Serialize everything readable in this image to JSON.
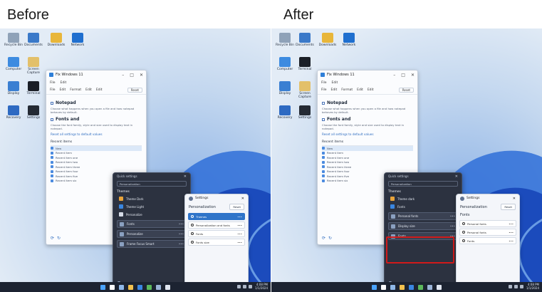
{
  "captions": {
    "before": "Before",
    "after": "After"
  },
  "colors": {
    "highlight": "#d11a1a",
    "accent": "#2f74c9",
    "taskbar": "#1c2331",
    "flyout_bg": "#2c3240"
  },
  "before": {
    "desktop_icons": [
      {
        "label": "Recycle Bin",
        "icon": "recycle-bin-icon",
        "color": "#8fa2b8"
      },
      {
        "label": "Documents",
        "icon": "folder-icon",
        "color": "#3a79c9"
      },
      {
        "label": "Downloads",
        "icon": "downloads-icon",
        "color": "#e8b63a"
      },
      {
        "label": "Network",
        "icon": "network-icon",
        "color": "#1f6fcf"
      },
      {
        "label": "Computer",
        "icon": "computer-icon",
        "color": "#3d8be0"
      },
      {
        "label": "Screen Capture",
        "icon": "capture-icon",
        "color": "#e3c06a"
      },
      {
        "label": "Display",
        "icon": "display-icon",
        "color": "#3a7fd2"
      },
      {
        "label": "Terminal",
        "icon": "terminal-icon",
        "color": "#1b1f27"
      },
      {
        "label": "Recovery",
        "icon": "recovery-icon",
        "color": "#2e6ac2"
      },
      {
        "label": "Settings",
        "icon": "settings-icon",
        "color": "#242a34"
      }
    ],
    "window": {
      "title": "Fix Windows 11",
      "menu": [
        "File",
        "Edit"
      ],
      "toolbar": [
        "File",
        "Edit",
        "Format",
        "Edit",
        "Edit"
      ],
      "toolbar_button": "Reset",
      "sections": [
        {
          "heading": "Notepad",
          "text": "Choose what happens when you open a file and how notepad behaves by default."
        },
        {
          "heading": "Fonts and",
          "text": "Choose the font family, style and size used to display text in notepad."
        }
      ],
      "link": "Reset all settings to default values",
      "list_heading": "Recent items",
      "list": [
        "New",
        "Recent item",
        "Recent item one",
        "Recent item two",
        "Recent item three",
        "Recent item four",
        "Recent item five",
        "Recent item six"
      ]
    },
    "flyout": {
      "top": "Quick settings",
      "search": "Personalization",
      "section": "Themes",
      "items": [
        {
          "label": "Theme Dark",
          "color": "#e8a33a",
          "boxed": false
        },
        {
          "label": "Theme Light",
          "color": "#3a86e0",
          "boxed": false
        },
        {
          "label": "Personalize",
          "color": "#d5dbe6",
          "boxed": false
        },
        {
          "label": "Fonts",
          "color": "#8aa0c0",
          "boxed": true
        },
        {
          "label": "Personalize",
          "color": "#8aa0c0",
          "boxed": true
        },
        {
          "label": "Frame Focus Smart",
          "color": "#8aa0c0",
          "boxed": true
        }
      ],
      "bottom": "Themes"
    },
    "settings": {
      "title": "Settings",
      "heading": "Personalization",
      "button": "Reset",
      "subheading": "",
      "rows": [
        {
          "label": "Themes",
          "active": true
        },
        {
          "label": "Personalization and fonts",
          "active": false
        },
        {
          "label": "Fonts",
          "active": false
        },
        {
          "label": "Fonts size",
          "active": false
        }
      ]
    },
    "taskbar": {
      "time": "4:08 PM",
      "date": "1/1/2024"
    }
  },
  "after": {
    "desktop_icons": [
      {
        "label": "Recycle Bin",
        "icon": "recycle-bin-icon",
        "color": "#8fa2b8"
      },
      {
        "label": "Documents",
        "icon": "folder-icon",
        "color": "#3a79c9"
      },
      {
        "label": "Downloads",
        "icon": "downloads-icon",
        "color": "#e8b63a"
      },
      {
        "label": "Network",
        "icon": "network-icon",
        "color": "#1f6fcf"
      },
      {
        "label": "Computer",
        "icon": "computer-icon",
        "color": "#3d8be0"
      },
      {
        "label": "Terminal",
        "icon": "terminal-icon",
        "color": "#1b1f27"
      },
      {
        "label": "Display",
        "icon": "display-icon",
        "color": "#3a7fd2"
      },
      {
        "label": "Screen Capture",
        "icon": "capture-icon",
        "color": "#e3c06a"
      },
      {
        "label": "Recovery",
        "icon": "recovery-icon",
        "color": "#2e6ac2"
      },
      {
        "label": "Settings",
        "icon": "settings-icon",
        "color": "#242a34"
      }
    ],
    "window": {
      "title": "Fix Windows 11",
      "menu": [
        "File",
        "Edit"
      ],
      "toolbar": [
        "File",
        "Edit",
        "Format",
        "Edit",
        "Edit"
      ],
      "toolbar_button": "Reset",
      "sections": [
        {
          "heading": "Notepad",
          "text": "Choose what happens when you open a file and how notepad behaves by default."
        },
        {
          "heading": "Fonts and",
          "text": "Choose the font family, style and size used to display text in notepad."
        }
      ],
      "link": "Reset all settings to default values",
      "list_heading": "Recent items",
      "list": [
        "New",
        "Recent item",
        "Recent item one",
        "Recent item two",
        "Recent item three",
        "Recent item four",
        "Recent item five",
        "Recent item six"
      ]
    },
    "flyout": {
      "top": "Quick settings",
      "search": "Personalization",
      "section": "Themes",
      "items": [
        {
          "label": "Theme dark",
          "color": "#e8a33a",
          "boxed": false
        },
        {
          "label": "Fonts",
          "color": "#3a86e0",
          "boxed": false
        },
        {
          "label": "Personal fonts",
          "color": "#8aa0c0",
          "boxed": true
        },
        {
          "label": "Display size",
          "color": "#8aa0c0",
          "boxed": true
        },
        {
          "label": "Fonts",
          "color": "#8aa0c0",
          "boxed": true
        }
      ],
      "bottom": "Display fonts"
    },
    "settings": {
      "title": "Settings",
      "heading": "Personalization",
      "button": "Reset",
      "subheading": "Fonts",
      "rows": [
        {
          "label": "Personal fonts",
          "active": false
        },
        {
          "label": "Personal fonts",
          "active": false
        },
        {
          "label": "Fonts",
          "active": false
        }
      ]
    },
    "taskbar": {
      "time": "4:08 PM",
      "date": "1/1/2024"
    }
  }
}
